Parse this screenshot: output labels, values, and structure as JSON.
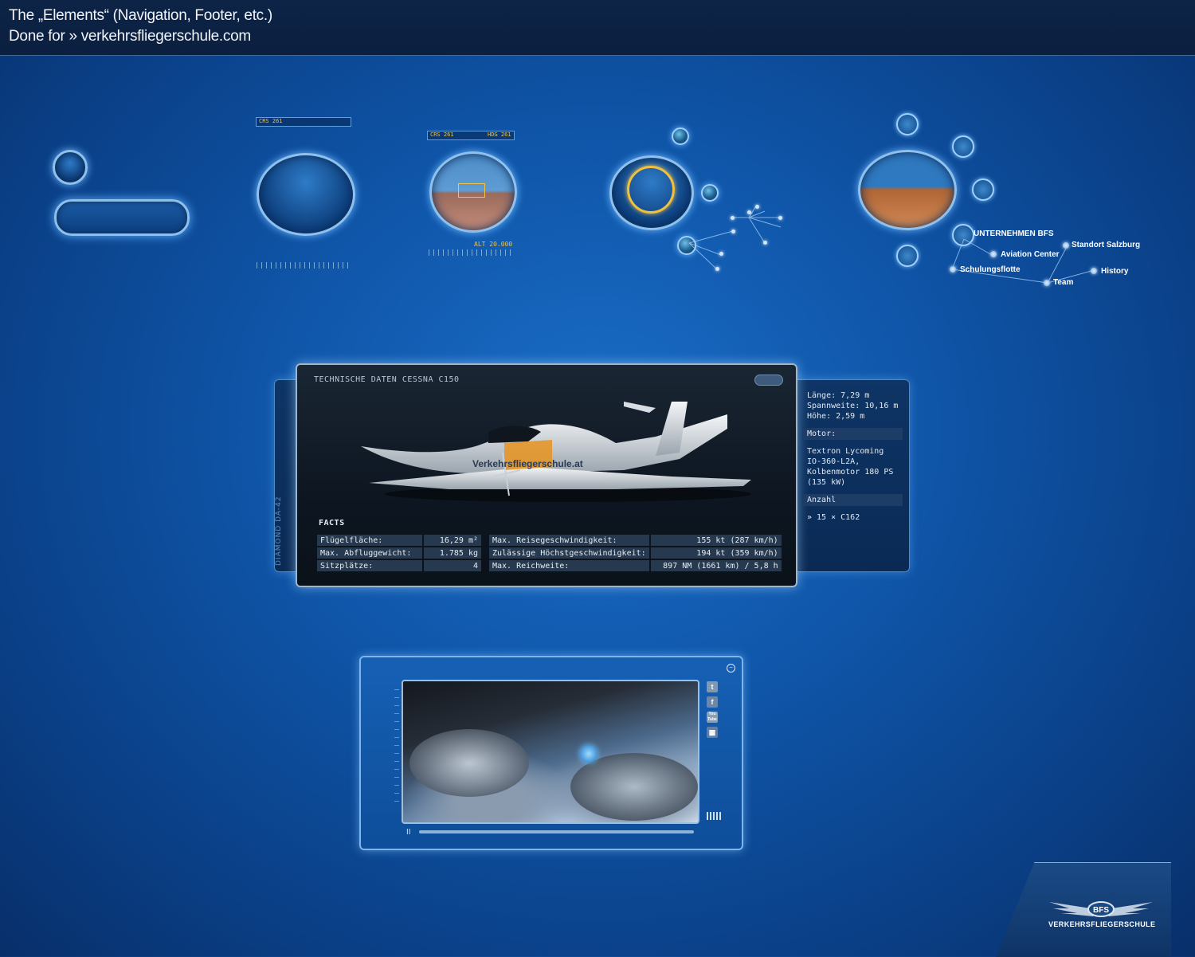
{
  "header": {
    "line1": "The „Elements“ (Navigation, Footer, etc.)",
    "line2": "Done for » verkehrsfliegerschule.com"
  },
  "hud": {
    "crs1": "CRS  261",
    "crs2": "CRS  261",
    "hdg": "HDG  261",
    "alt": "ALT 20.000"
  },
  "nav": {
    "unternehmen": "UNTERNEHMEN BFS",
    "standort": "Standort Salzburg",
    "aviation": "Aviation Center",
    "schulungsflotte": "Schulungsflotte",
    "history": "History",
    "team": "Team"
  },
  "panel": {
    "title": "TECHNISCHE DATEN  CESSNA C150",
    "side_label": "DIAMOND DA-42",
    "facts_label": "FACTS",
    "plane_text": "Verkehrsfliegerschule.at",
    "table_left": [
      {
        "k": "Flügelfläche:",
        "v": "16,29 m²"
      },
      {
        "k": "Max. Abfluggewicht:",
        "v": "1.785 kg"
      },
      {
        "k": "Sitzplätze:",
        "v": "4"
      }
    ],
    "table_right": [
      {
        "k": "Max. Reisegeschwindigkeit:",
        "v": "155 kt (287 km/h)"
      },
      {
        "k": "Zulässige Höchstgeschwindigkeit:",
        "v": "194 kt (359 km/h)"
      },
      {
        "k": "Max. Reichweite:",
        "v": "897 NM (1661 km) / 5,8 h"
      }
    ]
  },
  "specs": {
    "laenge": "Länge: 7,29 m",
    "spannweite": "Spannweite: 10,16 m",
    "hoehe": "Höhe: 2,59 m",
    "motor_hdr": "Motor:",
    "motor1": "Textron Lycoming",
    "motor2": "IO-360-L2A,",
    "motor3": "Kolbenmotor 180 PS",
    "motor4": "(135 kW)",
    "anzahl_hdr": "Anzahl",
    "anzahl": "» 15 × C162"
  },
  "player": {
    "pause": "II",
    "social": [
      "t",
      "f",
      "You Tube",
      "▦"
    ]
  },
  "footer": {
    "logo_badge": "BFS",
    "logo_name": "VERKEHRSFLIEGERSCHULE"
  }
}
